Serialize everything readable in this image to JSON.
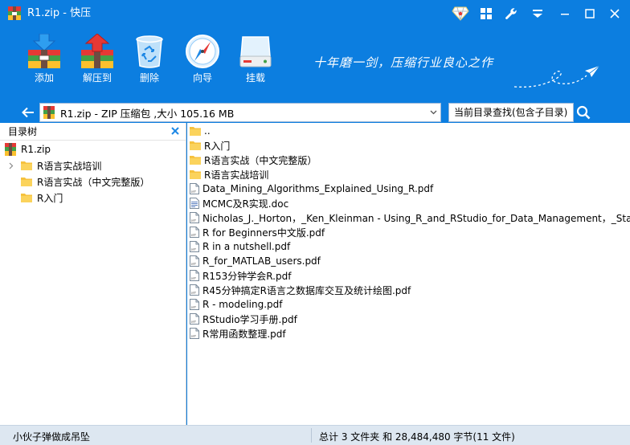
{
  "window": {
    "title": "R1.zip - 快压",
    "colors": {
      "accent": "#0c7ee0",
      "status_bar": "#dde7f1",
      "folder": "#f6c23e"
    }
  },
  "titlebar_icons": [
    "vip-diamond-icon",
    "apps-grid-icon",
    "wrench-icon",
    "menu-icon",
    "minimize-icon",
    "maximize-icon",
    "close-icon"
  ],
  "toolbar": {
    "items": [
      {
        "label": "添加",
        "icon": "add-archive-icon"
      },
      {
        "label": "解压到",
        "icon": "extract-to-icon"
      },
      {
        "label": "删除",
        "icon": "trash-icon"
      },
      {
        "label": "向导",
        "icon": "compass-icon"
      },
      {
        "label": "挂载",
        "icon": "mount-drive-icon"
      }
    ],
    "slogan": "十年磨一剑，压缩行业良心之作"
  },
  "address": {
    "path": "R1.zip - ZIP 压缩包 ,大小 105.16 MB",
    "search_placeholder": "当前目录查找(包含子目录)"
  },
  "tree": {
    "title": "目录树",
    "root": "R1.zip",
    "nodes": [
      {
        "label": "R语言实战培训",
        "expandable": true
      },
      {
        "label": "R语言实战（中文完整版）",
        "expandable": false
      },
      {
        "label": "R入门",
        "expandable": false
      }
    ]
  },
  "files": [
    {
      "name": "..",
      "type": "folder"
    },
    {
      "name": "R入门",
      "type": "folder"
    },
    {
      "name": "R语言实战（中文完整版）",
      "type": "folder"
    },
    {
      "name": "R语言实战培训",
      "type": "folder"
    },
    {
      "name": "Data_Mining_Algorithms_Explained_Using_R.pdf",
      "type": "pdf"
    },
    {
      "name": "MCMC及R实现.doc",
      "type": "doc"
    },
    {
      "name": "Nicholas_J._Horton，_Ken_Kleinman - Using_R_and_RStudio_for_Data_Management，_Statist",
      "type": "pdf"
    },
    {
      "name": "R for Beginners中文版.pdf",
      "type": "pdf"
    },
    {
      "name": "R in a nutshell.pdf",
      "type": "pdf"
    },
    {
      "name": "R_for_MATLAB_users.pdf",
      "type": "pdf"
    },
    {
      "name": "R153分钟学会R.pdf",
      "type": "pdf"
    },
    {
      "name": "R45分钟搞定R语言之数据库交互及统计绘图.pdf",
      "type": "pdf"
    },
    {
      "name": "R - modeling.pdf",
      "type": "pdf"
    },
    {
      "name": "RStudio学习手册.pdf",
      "type": "pdf"
    },
    {
      "name": "R常用函数整理.pdf",
      "type": "pdf"
    }
  ],
  "status": {
    "left": "小伙子弹做成吊坠",
    "right": "总计 3 文件夹 和 28,484,480 字节(11 文件)"
  }
}
